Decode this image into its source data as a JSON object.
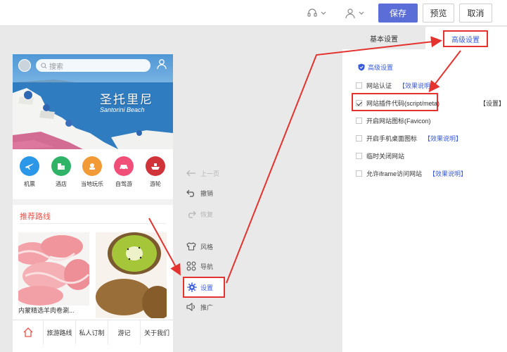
{
  "toolbar": {
    "save_label": "保存",
    "preview_label": "预览",
    "cancel_label": "取消"
  },
  "phone": {
    "search_placeholder": "搜索",
    "hero_title": "圣托里尼",
    "hero_subtitle": "Santorini Beach",
    "categories": [
      {
        "label": "机票",
        "color": "#2a97e8",
        "icon": "plane-icon"
      },
      {
        "label": "酒店",
        "color": "#2fb467",
        "icon": "hotel-icon"
      },
      {
        "label": "当地玩乐",
        "color": "#f29a36",
        "icon": "fun-icon"
      },
      {
        "label": "自驾游",
        "color": "#ef4f79",
        "icon": "car-icon"
      },
      {
        "label": "游轮",
        "color": "#d1333a",
        "icon": "ship-icon"
      }
    ],
    "recommend_title": "推荐路线",
    "card_caption": "内蒙精选羊肉卷涮...",
    "bottom_nav": [
      "旅游路线",
      "私人订制",
      "游记",
      "关于我们"
    ]
  },
  "tools": {
    "prev": "上一页",
    "undo": "撤销",
    "redo": "恢复",
    "style": "风格",
    "nav": "导航",
    "settings": "设置",
    "promote": "推广"
  },
  "panel": {
    "tab_basic": "基本设置",
    "tab_advanced": "高级设置",
    "section_title": "高级设置",
    "options": [
      {
        "label": "网站认证",
        "link": "【效果说明】",
        "checked": false
      },
      {
        "label": "网站插件代码(script/meta)",
        "link": "",
        "checked": true
      },
      {
        "label": "开启网站图标(Favicon)",
        "link": "",
        "checked": false
      },
      {
        "label": "开启手机桌面图标",
        "link": "【效果说明】",
        "checked": false
      },
      {
        "label": "临时关闭网站",
        "link": "",
        "checked": false
      },
      {
        "label": "允许iframe访问网站",
        "link": "【效果说明】",
        "checked": false
      }
    ],
    "setting_link": "【设置】"
  },
  "colors": {
    "accent": "#5b6ed8",
    "highlight": "#e4332e",
    "link": "#3a5bd9",
    "recommend": "#e8524a"
  }
}
